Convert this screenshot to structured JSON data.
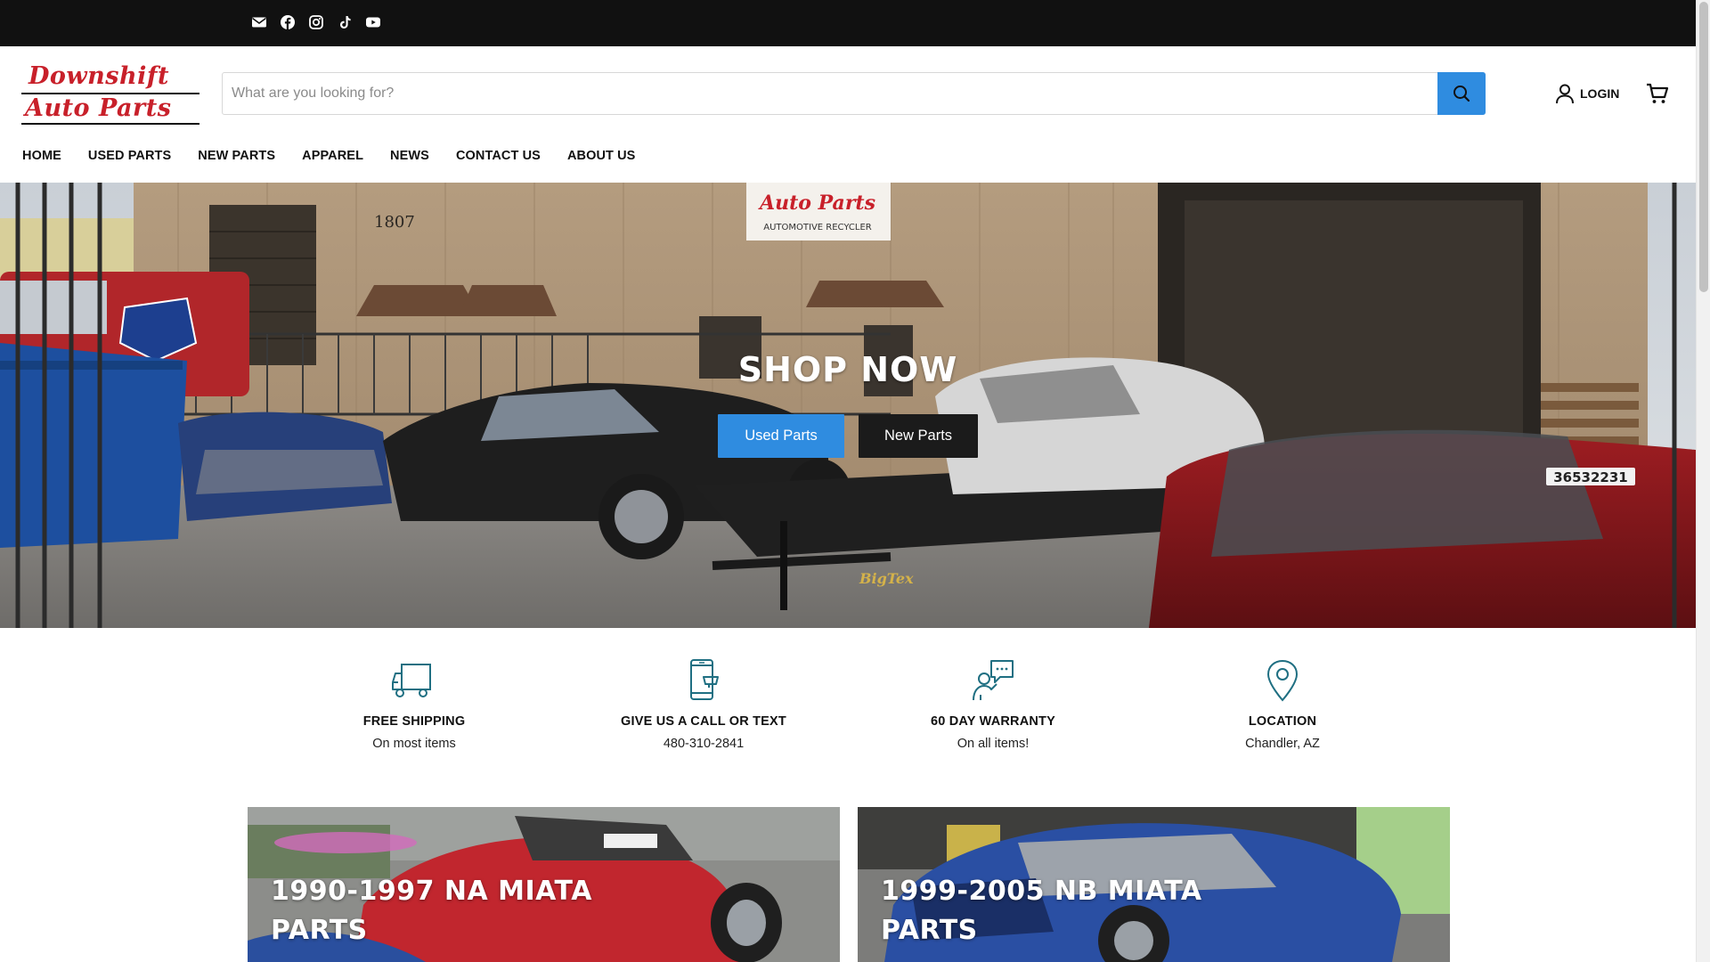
{
  "social": {
    "items": [
      {
        "name": "email-icon"
      },
      {
        "name": "facebook-icon"
      },
      {
        "name": "instagram-icon"
      },
      {
        "name": "tiktok-icon"
      },
      {
        "name": "youtube-icon"
      }
    ]
  },
  "header": {
    "logo_line1": "Downshift",
    "logo_line2": "Auto Parts",
    "search_placeholder": "What are you looking for?",
    "login_label": "LOGIN"
  },
  "nav": {
    "items": [
      "HOME",
      "USED PARTS",
      "NEW PARTS",
      "APPAREL",
      "NEWS",
      "CONTACT US",
      "ABOUT US"
    ]
  },
  "hero": {
    "title": "SHOP NOW",
    "used_button": "Used Parts",
    "new_button": "New Parts"
  },
  "features": [
    {
      "icon": "truck-icon",
      "title": "FREE SHIPPING",
      "subtitle": "On most items"
    },
    {
      "icon": "phone-icon",
      "title": "GIVE US A CALL OR TEXT",
      "subtitle": "480-310-2841"
    },
    {
      "icon": "warranty-support-icon",
      "title": "60 DAY WARRANTY",
      "subtitle": "On all items!"
    },
    {
      "icon": "location-pin-icon",
      "title": "LOCATION",
      "subtitle": "Chandler, AZ"
    }
  ],
  "cards": [
    {
      "title_line1": "1990-1997 NA MIATA",
      "title_line2": "PARTS"
    },
    {
      "title_line1": "1999-2005 NB MIATA",
      "title_line2": "PARTS"
    }
  ],
  "colors": {
    "accent_blue": "#2f8ce0",
    "logo_red": "#c8202a",
    "icon_teal": "#1f6f82",
    "topbar": "#111111"
  }
}
